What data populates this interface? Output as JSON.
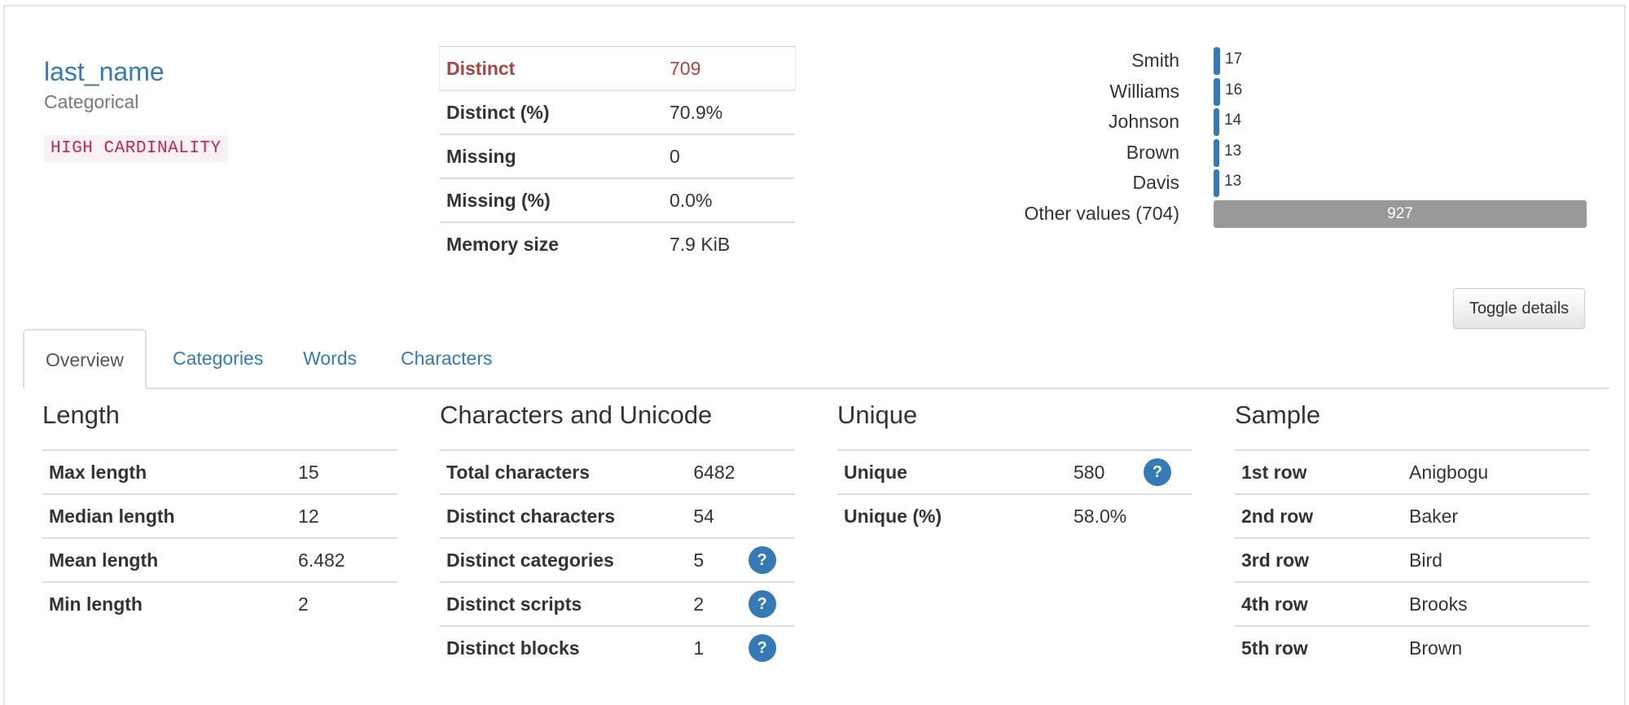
{
  "variable": {
    "name": "last_name",
    "type": "Categorical",
    "badge": "HIGH CARDINALITY"
  },
  "top_stats": [
    {
      "label": "Distinct",
      "value": "709",
      "alert": true
    },
    {
      "label": "Distinct (%)",
      "value": "70.9%"
    },
    {
      "label": "Missing",
      "value": "0"
    },
    {
      "label": "Missing (%)",
      "value": "0.0%"
    },
    {
      "label": "Memory size",
      "value": "7.9 KiB"
    }
  ],
  "frequencies": {
    "items": [
      {
        "label": "Smith",
        "count": 17
      },
      {
        "label": "Williams",
        "count": 16
      },
      {
        "label": "Johnson",
        "count": 14
      },
      {
        "label": "Brown",
        "count": 13
      },
      {
        "label": "Davis",
        "count": 13
      }
    ],
    "other": {
      "label": "Other values (704)",
      "count": 927
    }
  },
  "toggle_label": "Toggle details",
  "tabs": [
    "Overview",
    "Categories",
    "Words",
    "Characters"
  ],
  "active_tab": "Overview",
  "length": {
    "title": "Length",
    "rows": [
      {
        "label": "Max length",
        "value": "15"
      },
      {
        "label": "Median length",
        "value": "12"
      },
      {
        "label": "Mean length",
        "value": "6.482"
      },
      {
        "label": "Min length",
        "value": "2"
      }
    ]
  },
  "chars": {
    "title": "Characters and Unicode",
    "rows": [
      {
        "label": "Total characters",
        "value": "6482",
        "help": false
      },
      {
        "label": "Distinct characters",
        "value": "54",
        "help": false
      },
      {
        "label": "Distinct categories",
        "value": "5",
        "help": true
      },
      {
        "label": "Distinct scripts",
        "value": "2",
        "help": true
      },
      {
        "label": "Distinct blocks",
        "value": "1",
        "help": true
      }
    ]
  },
  "unique": {
    "title": "Unique",
    "rows": [
      {
        "label": "Unique",
        "value": "580",
        "help": true
      },
      {
        "label": "Unique (%)",
        "value": "58.0%",
        "help": false
      }
    ]
  },
  "sample": {
    "title": "Sample",
    "rows": [
      {
        "label": "1st row",
        "value": "Anigbogu"
      },
      {
        "label": "2nd row",
        "value": "Baker"
      },
      {
        "label": "3rd row",
        "value": "Bird"
      },
      {
        "label": "4th row",
        "value": "Brooks"
      },
      {
        "label": "5th row",
        "value": "Brown"
      }
    ]
  },
  "help_glyph": "?",
  "colors": {
    "link": "#337ab7",
    "alert": "#a94442",
    "badge_text": "#c7254e",
    "other_bar": "#999999"
  }
}
